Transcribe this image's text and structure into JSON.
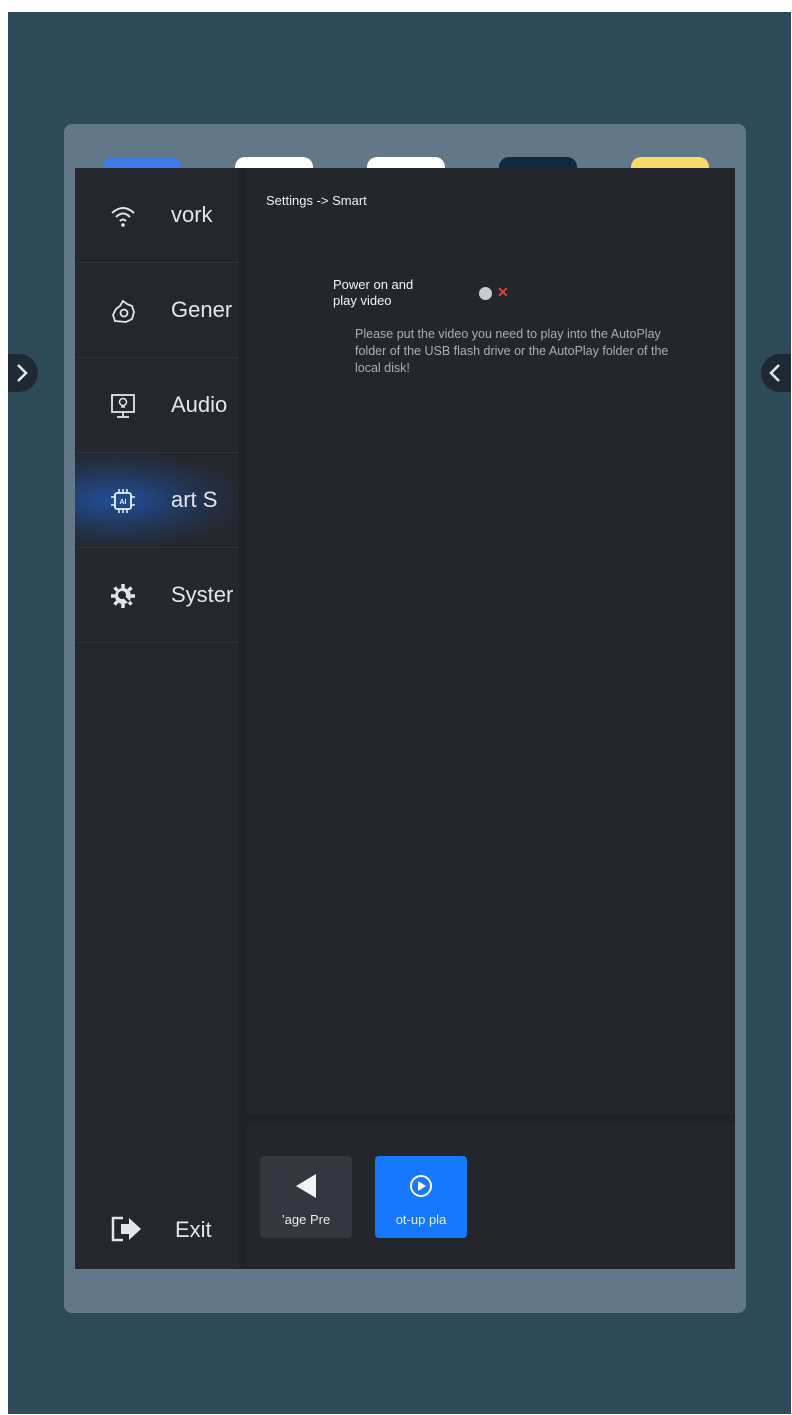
{
  "colors": {
    "background": "#2e4a58",
    "frame": "#627888",
    "panel": "#1f2228",
    "accent": "#1677ff",
    "toggle_off_x": "#e0403a"
  },
  "top_tabs": [
    {
      "color": "#3f7be6"
    },
    {
      "color": "#ffffff"
    },
    {
      "color": "#ffffff"
    },
    {
      "color": "#0f2a3e"
    },
    {
      "color": "#f6db6a"
    }
  ],
  "sidebar": {
    "items": [
      {
        "label": "vork",
        "icon": "wifi-icon"
      },
      {
        "label": "Gener",
        "icon": "settings-cloud-icon"
      },
      {
        "label": "Audio",
        "icon": "monitor-bulb-icon"
      },
      {
        "label": "art S",
        "icon": "ai-chip-icon",
        "active": true
      },
      {
        "label": "Syster",
        "icon": "system-gear-icon"
      }
    ],
    "exit_label": "Exit",
    "exit_icon": "exit-icon"
  },
  "main": {
    "breadcrumb": "Settings -> Smart",
    "setting": {
      "label_line1": "Power on and",
      "label_line2": "play video",
      "toggle_state": "off",
      "help_text": "Please put the video you need to play into the AutoPlay folder of the USB flash drive or the AutoPlay folder of the local disk!"
    }
  },
  "bottom_bar": {
    "buttons": [
      {
        "label": "’age   Pre",
        "icon": "triangle-left-icon"
      },
      {
        "label": "ot-up pla",
        "icon": "play-circle-icon",
        "active": true
      }
    ]
  },
  "edge_arrows": {
    "left_icon": "chevron-right-icon",
    "right_icon": "chevron-left-icon"
  }
}
